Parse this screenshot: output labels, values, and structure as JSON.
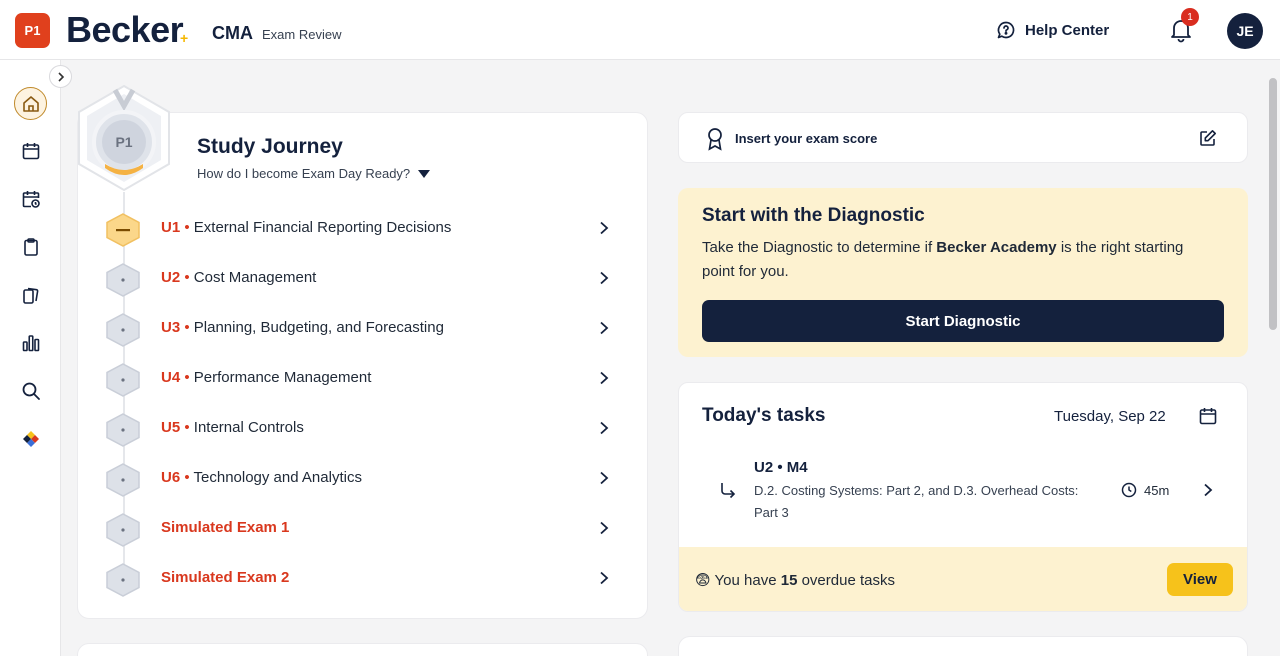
{
  "header": {
    "part_badge": "P1",
    "logo": "Becker",
    "exam_code": "CMA",
    "exam_sub": "Exam Review",
    "help_label": "Help Center",
    "notification_count": "1",
    "avatar_initials": "JE"
  },
  "sidebar": {
    "items": [
      {
        "name": "home",
        "active": true
      },
      {
        "name": "calendar"
      },
      {
        "name": "study-plan"
      },
      {
        "name": "clipboard"
      },
      {
        "name": "flashcards"
      },
      {
        "name": "performance"
      },
      {
        "name": "search"
      },
      {
        "name": "academy"
      }
    ]
  },
  "journey": {
    "medal_label": "P1",
    "title": "Study Journey",
    "subtitle": "How do I become Exam Day Ready?",
    "units": [
      {
        "code": "U1",
        "sep": " •",
        "name": " External Financial Reporting Decisions",
        "status": "in-progress"
      },
      {
        "code": "U2",
        "sep": " •",
        "name": " Cost Management",
        "status": "not-started"
      },
      {
        "code": "U3",
        "sep": " •",
        "name": " Planning, Budgeting, and Forecasting",
        "status": "not-started"
      },
      {
        "code": "U4",
        "sep": " •",
        "name": " Performance Management",
        "status": "not-started"
      },
      {
        "code": "U5",
        "sep": " •",
        "name": " Internal Controls",
        "status": "not-started"
      },
      {
        "code": "U6",
        "sep": " •",
        "name": " Technology and Analytics",
        "status": "not-started"
      }
    ],
    "sim_exams": [
      "Simulated Exam 1",
      "Simulated Exam 2"
    ]
  },
  "score": {
    "label": "Insert your exam score"
  },
  "diagnostic": {
    "title": "Start with the Diagnostic",
    "text_before": "Take the Diagnostic to determine if ",
    "text_bold": "Becker Academy",
    "text_after": " is the right starting point for you.",
    "button": "Start Diagnostic"
  },
  "tasks": {
    "title": "Today's tasks",
    "date": "Tuesday, Sep 22",
    "item": {
      "code": "U2 • M4",
      "description": "D.2. Costing Systems: Part 2, and D.3. Overhead Costs: Part 3",
      "duration": "45m"
    },
    "overdue_prefix": "You have ",
    "overdue_count": "15",
    "overdue_suffix": " overdue tasks",
    "overdue_emoji": "😨",
    "view_button": "View"
  },
  "colors": {
    "brand_navy": "#14213d",
    "accent_red": "#d9381e",
    "accent_yellow": "#f6c21b",
    "cream": "#fdf2d0"
  }
}
